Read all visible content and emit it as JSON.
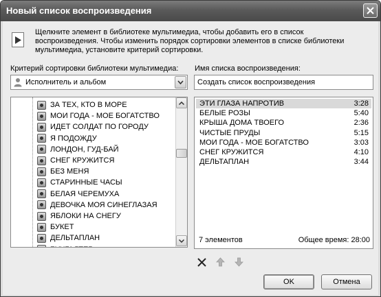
{
  "window": {
    "title": "Новый список воспроизведения"
  },
  "info": {
    "text": "Щелкните элемент в библиотеке мультимедиа, чтобы добавить его в список воспроизведения. Чтобы изменить порядок сортировки элементов в списке библиотеки мультимедиа, установите критерий сортировки."
  },
  "sort": {
    "label": "Критерий сортировки библиотеки мультимедиа:",
    "value": "Исполнитель и альбом"
  },
  "playlist_name": {
    "label": "Имя списка воспроизведения:",
    "value": "Создать список воспроизведения"
  },
  "library": {
    "items": [
      "ЗА ТЕХ, КТО В МОРЕ",
      "МОИ ГОДА - МОЕ БОГАТСТВО",
      "ИДЕТ СОЛДАТ ПО ГОРОДУ",
      "Я ПОДОЖДУ",
      "ЛОНДОН, ГУД-БАЙ",
      "СНЕГ КРУЖИТСЯ",
      "БЕЗ МЕНЯ",
      "СТАРИННЫЕ ЧАСЫ",
      "БЕЛАЯ ЧЕРЕМУХА",
      "ДЕВОЧКА МОЯ СИНЕГЛАЗАЯ",
      "ЯБЛОКИ НА СНЕГУ",
      "БУКЕТ",
      "ДЕЛЬТАПЛАН",
      "БУХГАЛТЕР"
    ]
  },
  "playlist": {
    "rows": [
      {
        "title": "ЭТИ ГЛАЗА НАПРОТИВ",
        "duration": "3:28"
      },
      {
        "title": "БЕЛЫЕ РОЗЫ",
        "duration": "5:40"
      },
      {
        "title": "КРЫША ДОМА ТВОЕГО",
        "duration": "2:36"
      },
      {
        "title": "ЧИСТЫЕ ПРУДЫ",
        "duration": "5:15"
      },
      {
        "title": "МОИ ГОДА - МОЕ БОГАТСТВО",
        "duration": "3:03"
      },
      {
        "title": "СНЕГ КРУЖИТСЯ",
        "duration": "4:10"
      },
      {
        "title": "ДЕЛЬТАПЛАН",
        "duration": "3:44"
      }
    ],
    "count": "7 элементов",
    "total_time": "Общее время: 28:00"
  },
  "buttons": {
    "ok": "OK",
    "cancel": "Отмена"
  },
  "icons": {
    "close": "close-icon",
    "remove": "remove-icon",
    "move_up": "arrow-up-icon",
    "move_down": "arrow-down-icon",
    "song": "song-icon",
    "person": "person-icon"
  }
}
